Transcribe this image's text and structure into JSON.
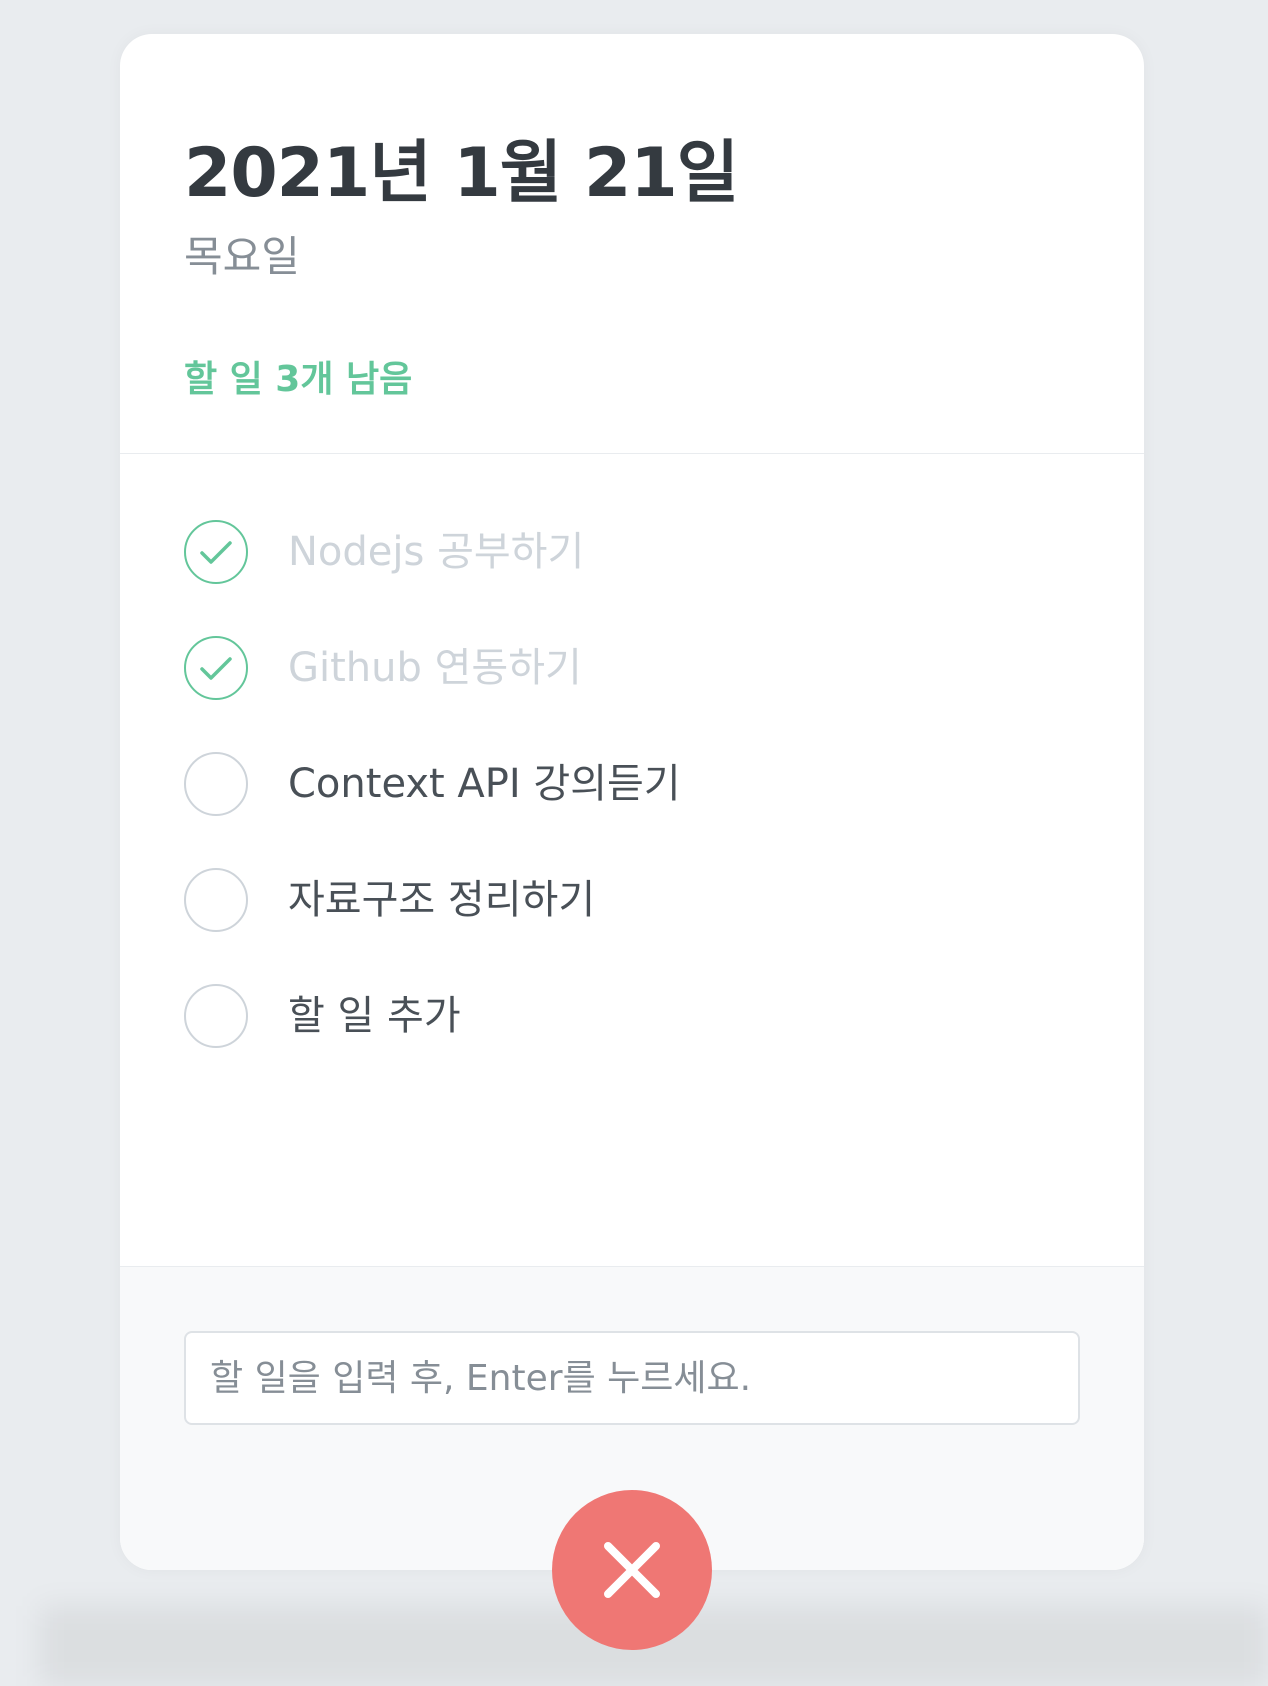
{
  "header": {
    "date": "2021년 1월 21일",
    "day": "목요일",
    "tasks_left": "할 일 3개 남음"
  },
  "todos": [
    {
      "text": "Nodejs 공부하기",
      "done": true
    },
    {
      "text": "Github 연동하기",
      "done": true
    },
    {
      "text": "Context API 강의듣기",
      "done": false
    },
    {
      "text": "자료구조 정리하기",
      "done": false
    },
    {
      "text": "할 일 추가",
      "done": false
    }
  ],
  "input": {
    "placeholder": "할 일을 입력 후, Enter를 누르세요.",
    "value": ""
  },
  "close_button": {
    "icon": "close-icon"
  },
  "colors": {
    "accent": "#63c69a",
    "close": "#ef7774",
    "text": "#343a40",
    "muted": "#868e96",
    "done_text": "#ced4da"
  }
}
